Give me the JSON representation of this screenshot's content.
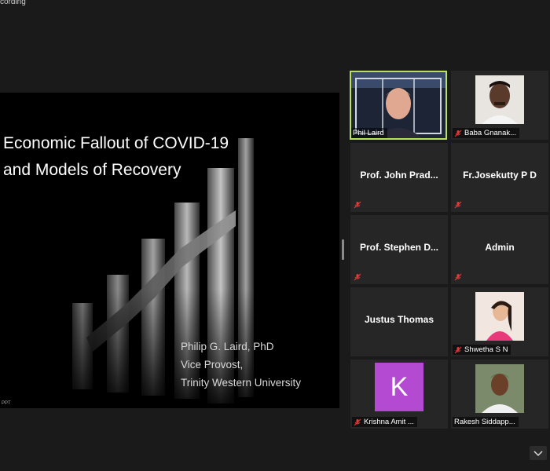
{
  "recording": {
    "label": "cording"
  },
  "slide": {
    "title_line1": "Economic Fallout of COVID-19",
    "title_line2": "and Models of Recovery",
    "presenter_name": "Philip G. Laird, PhD",
    "presenter_role": "Vice Provost,",
    "presenter_org": "Trinity Western University",
    "tag": "PPT"
  },
  "participants": [
    {
      "name": "Phil Laird",
      "type": "video",
      "muted": false,
      "active": true
    },
    {
      "name": "Baba Gnanak...",
      "type": "photo",
      "muted": true
    },
    {
      "name": "Prof. John Prad...",
      "type": "name",
      "muted": true
    },
    {
      "name": "Fr.Josekutty P D",
      "type": "name",
      "muted": true
    },
    {
      "name": "Prof. Stephen D...",
      "type": "name",
      "muted": true
    },
    {
      "name": "Admin",
      "type": "name",
      "muted": true
    },
    {
      "name": "Justus Thomas",
      "type": "name",
      "muted": false
    },
    {
      "name": "Shwetha S N",
      "type": "photo",
      "muted": true
    },
    {
      "name": "Krishna Amit ...",
      "type": "initial",
      "initial": "K",
      "muted": true
    },
    {
      "name": "Rakesh Siddapp...",
      "type": "photo",
      "muted": false
    }
  ],
  "colors": {
    "active_border": "#b9e25a",
    "mute_icon": "#e23a3a",
    "avatar_bg": "#b44ad2"
  }
}
